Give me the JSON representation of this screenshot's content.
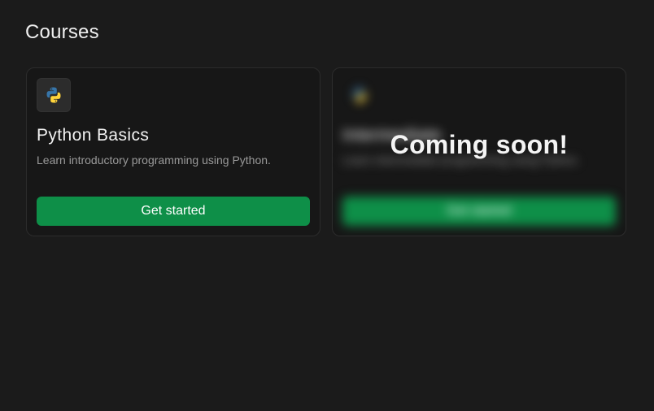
{
  "page": {
    "title": "Courses"
  },
  "courses": [
    {
      "icon": "python-logo-icon",
      "title": "Python Basics",
      "description": "Learn introductory programming using Python.",
      "cta_label": "Get started",
      "locked": false
    },
    {
      "icon": "python-logo-icon",
      "title": "Intermediate",
      "description": "Learn intermediate programming using Python.",
      "cta_label": "Get started",
      "locked": true,
      "overlay_text": "Coming soon!"
    }
  ],
  "colors": {
    "background": "#1b1b1b",
    "card_background": "#171717",
    "accent": "#0e8f48",
    "python_blue": "#3775a9",
    "python_yellow": "#ffd43b"
  }
}
